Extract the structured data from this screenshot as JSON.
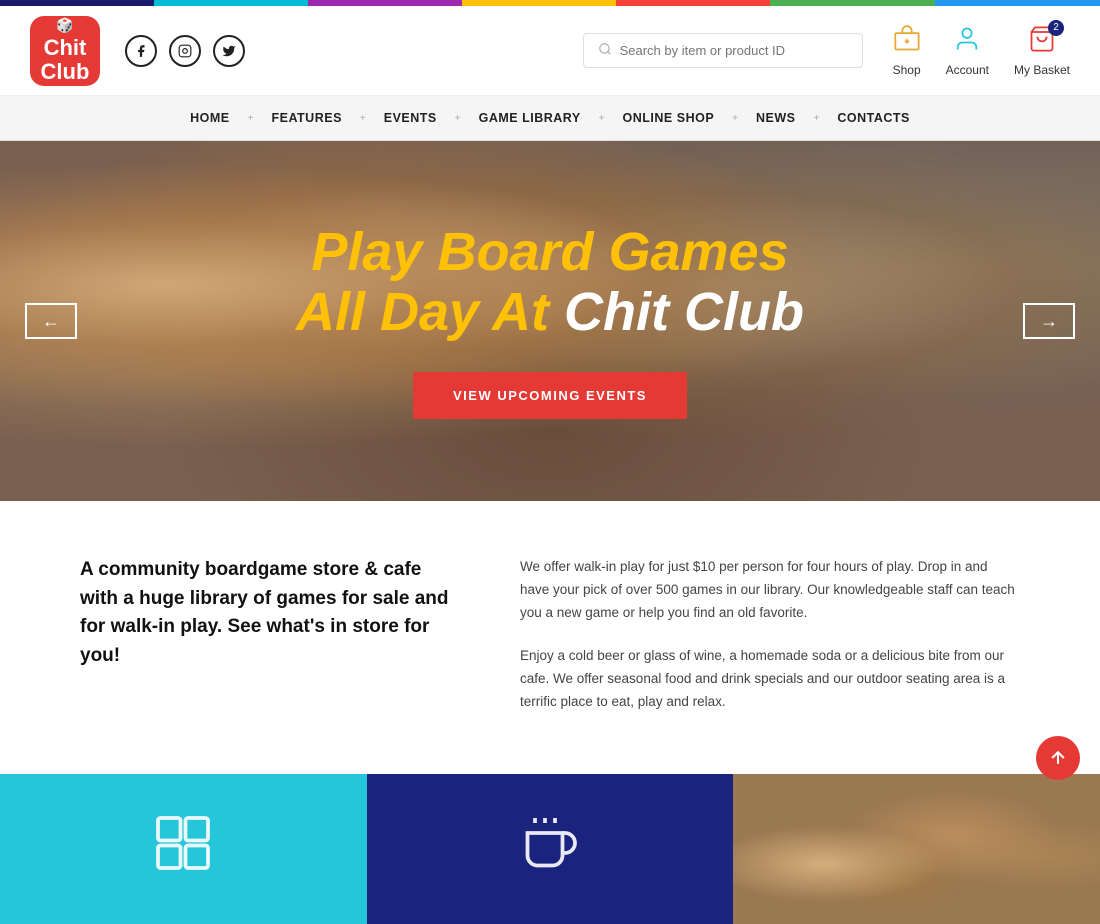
{
  "topBar": {},
  "header": {
    "logo": {
      "line1": "Chit",
      "line2": "Club"
    },
    "social": [
      {
        "name": "facebook",
        "icon": "f"
      },
      {
        "name": "instagram",
        "icon": "◉"
      },
      {
        "name": "twitter",
        "icon": "🐦"
      }
    ],
    "search": {
      "placeholder": "Search by item or product ID"
    },
    "actions": [
      {
        "label": "Shop",
        "icon": "🏪"
      },
      {
        "label": "Account",
        "icon": "👤"
      },
      {
        "label": "My Basket",
        "icon": "🛒",
        "badge": "2"
      }
    ]
  },
  "nav": {
    "items": [
      "HOME",
      "FEATURES",
      "EVENTS",
      "GAME LIBRARY",
      "ONLINE SHOP",
      "NEWS",
      "CONTACTS"
    ]
  },
  "hero": {
    "title_line1": "Play Board Games",
    "title_line2_plain": "All Day At ",
    "title_line2_white": "Chit Club",
    "cta_button": "VIEW UPCOMING EVENTS",
    "arrow_left": "←",
    "arrow_right": "→"
  },
  "about": {
    "left_text": "A community boardgame store & cafe with a huge library of games for sale and for walk-in play. See what's in store for you!",
    "right_para1": "We offer walk-in play for just $10 per person for four hours of play. Drop in and have your pick of over 500 games in our library. Our knowledgeable staff can teach you a new game or help you find an old favorite.",
    "right_para2": "Enjoy a cold beer or glass of wine, a homemade soda or a delicious bite from our cafe. We offer seasonal food and drink specials and our outdoor seating area is a terrific place to eat, play and relax."
  },
  "featureCards": [
    {
      "type": "teal",
      "icon": "🎲"
    },
    {
      "type": "dark-blue",
      "icon": "🍺"
    }
  ]
}
